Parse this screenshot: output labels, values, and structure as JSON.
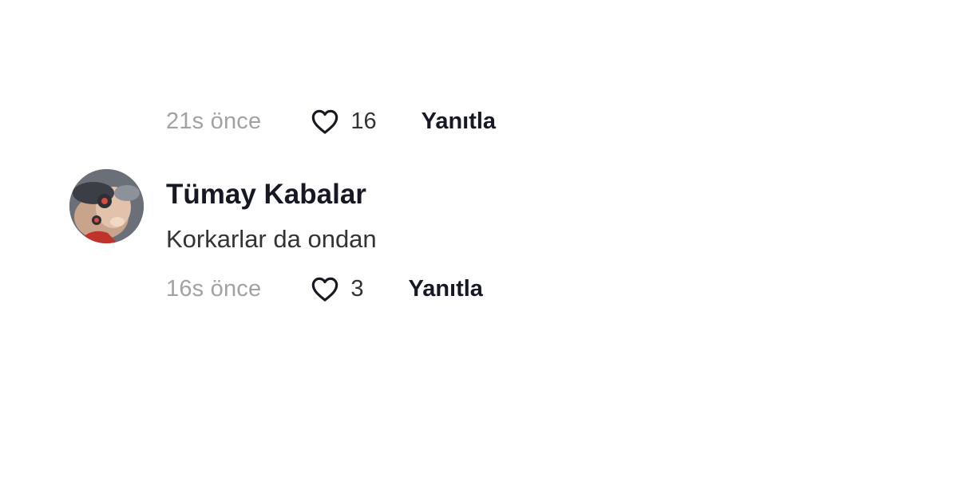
{
  "comments": [
    {
      "timestamp": "21s önce",
      "like_count": "16",
      "reply_label": "Yanıtla",
      "icon": "heart-outline-icon"
    },
    {
      "author": "Tümay Kabalar",
      "text": "Korkarlar da ondan",
      "timestamp": "16s önce",
      "like_count": "3",
      "reply_label": "Yanıtla",
      "icon": "heart-outline-icon"
    }
  ],
  "colors": {
    "timestamp": "#a2a2a2",
    "username": "#161823",
    "body_text": "#333333",
    "reply": "#161823"
  }
}
